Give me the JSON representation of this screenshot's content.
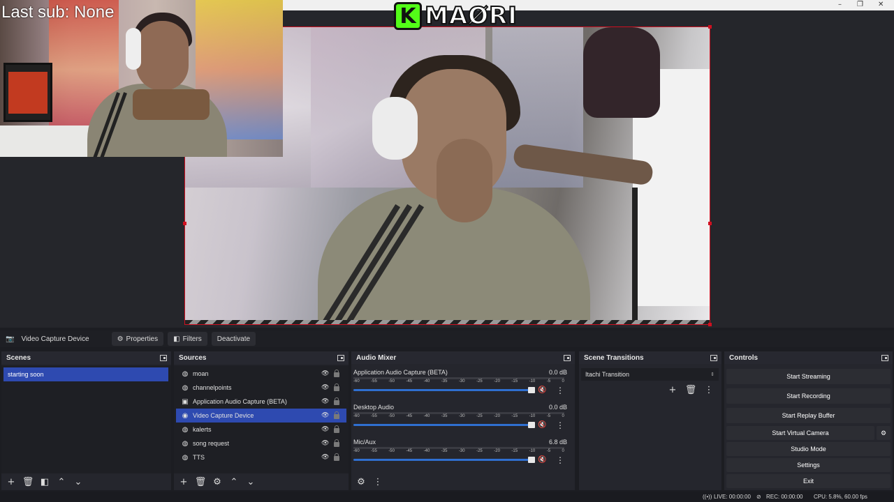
{
  "overlay": {
    "last_sub": "Last sub: None",
    "brand_k": "K",
    "brand_text": "MAØRI"
  },
  "window_controls": {
    "minimize": "–",
    "restore": "❐",
    "close": "✕"
  },
  "source_toolbar": {
    "source_name": "Video Capture Device",
    "properties": "Properties",
    "filters": "Filters",
    "deactivate": "Deactivate"
  },
  "scenes": {
    "title": "Scenes",
    "items": [
      "starting soon"
    ],
    "selected": 0
  },
  "sources": {
    "title": "Sources",
    "items": [
      {
        "name": "moan",
        "icon": "globe-icon"
      },
      {
        "name": "channelpoints",
        "icon": "globe-icon"
      },
      {
        "name": "Application Audio Capture (BETA)",
        "icon": "window-icon"
      },
      {
        "name": "Video Capture Device",
        "icon": "camera-icon"
      },
      {
        "name": "kalerts",
        "icon": "globe-icon"
      },
      {
        "name": "song request",
        "icon": "globe-icon"
      },
      {
        "name": "TTS",
        "icon": "globe-icon"
      }
    ],
    "selected": 3
  },
  "audio_mixer": {
    "title": "Audio Mixer",
    "ticks": [
      "-60",
      "-55",
      "-50",
      "-45",
      "-40",
      "-35",
      "-30",
      "-25",
      "-20",
      "-15",
      "-10",
      "-5",
      "0"
    ],
    "channels": [
      {
        "name": "Application Audio Capture (BETA)",
        "db": "0.0 dB"
      },
      {
        "name": "Desktop Audio",
        "db": "0.0 dB"
      },
      {
        "name": "Mic/Aux",
        "db": "6.8 dB"
      }
    ]
  },
  "scene_transitions": {
    "title": "Scene Transitions",
    "selected": "Itachi Transition"
  },
  "controls": {
    "title": "Controls",
    "buttons": [
      "Start Streaming",
      "Start Recording",
      "Start Replay Buffer",
      "Start Virtual Camera",
      "Studio Mode",
      "Settings",
      "Exit"
    ]
  },
  "status": {
    "live": "LIVE: 00:00:00",
    "rec": "REC: 00:00:00",
    "cpu": "CPU: 5.8%, 60.00 fps"
  },
  "colors": {
    "accent": "#2e4ab0",
    "selection_border": "#d01020",
    "kick_green": "#53fc18",
    "dock_bg": "#25262d"
  }
}
